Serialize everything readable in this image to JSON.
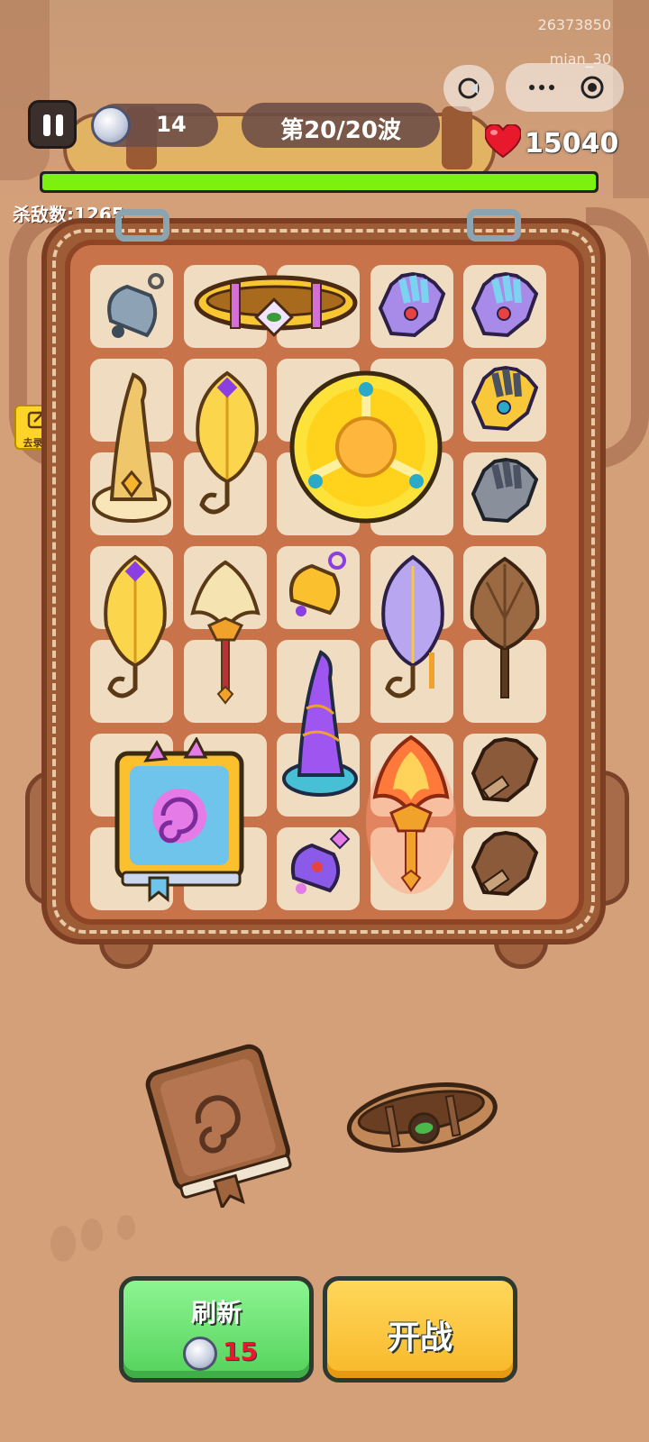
{
  "system": {
    "user_id": "26373850",
    "user_name": "mian_30",
    "menu_icon": "more-dots-icon",
    "close_icon": "target-circle-icon",
    "mini_icon": "pacman-icon"
  },
  "hud": {
    "coins": "14",
    "wave": "第20/20波",
    "hp": "15040",
    "hp_fraction": 1.0,
    "kills": "杀敌数:1265",
    "record_label": "去录制"
  },
  "bag": {
    "items": [
      {
        "name": "bell-silver",
        "icon": "🔔"
      },
      {
        "name": "belt-gold",
        "icon": "belt"
      },
      {
        "name": "glove-purple",
        "icon": "🧤"
      },
      {
        "name": "glove-purple-2",
        "icon": "🧤"
      },
      {
        "name": "wizard-hat-gold",
        "icon": "hat"
      },
      {
        "name": "feather-fan-gold",
        "icon": "fan"
      },
      {
        "name": "shield-gold",
        "icon": "shield"
      },
      {
        "name": "glove-gold",
        "icon": "🧤"
      },
      {
        "name": "glove-grey",
        "icon": "🧤"
      },
      {
        "name": "feather-fan-gold-2",
        "icon": "fan"
      },
      {
        "name": "feather-staff",
        "icon": "staff"
      },
      {
        "name": "bell-gold",
        "icon": "🔔"
      },
      {
        "name": "feather-fan-purple",
        "icon": "fan"
      },
      {
        "name": "leaf-fan-brown",
        "icon": "fan"
      },
      {
        "name": "spellbook-gold",
        "icon": "book"
      },
      {
        "name": "wizard-hat-purple",
        "icon": "hat"
      },
      {
        "name": "flame-staff",
        "icon": "staff"
      },
      {
        "name": "glove-brown",
        "icon": "🧤"
      },
      {
        "name": "bell-purple",
        "icon": "🔔"
      },
      {
        "name": "glove-brown-2",
        "icon": "🧤"
      }
    ]
  },
  "shop": {
    "items": [
      {
        "name": "spellbook-brown",
        "icon": "book"
      },
      {
        "name": "belt-brown",
        "icon": "belt"
      }
    ]
  },
  "buttons": {
    "refresh_label": "刷新",
    "refresh_cost": "15",
    "fight_label": "开战"
  },
  "colors": {
    "background": "#d4a07a",
    "hp_bar": "#7cf00f",
    "refresh_button": "#6fe376",
    "fight_button": "#fbc63a",
    "cost_text": "#e8192c"
  }
}
